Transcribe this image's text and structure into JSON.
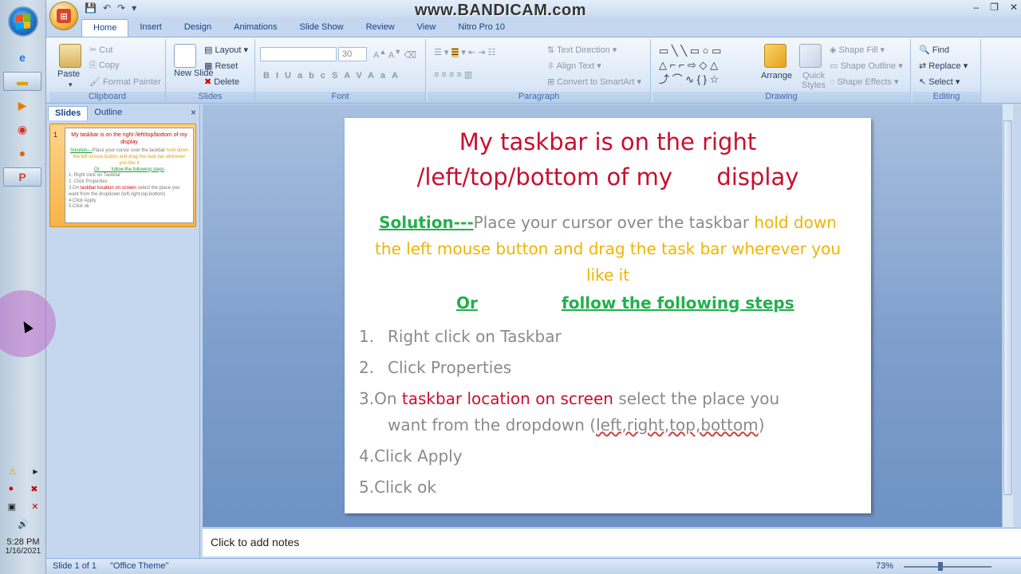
{
  "watermark": "www.BANDICAM.com",
  "qat": {
    "save": "💾",
    "undo": "↶",
    "redo": "↷",
    "more": "▾"
  },
  "window_controls": {
    "minimize": "‒",
    "restore": "❐",
    "close": "✕"
  },
  "tabs": [
    "Home",
    "Insert",
    "Design",
    "Animations",
    "Slide Show",
    "Review",
    "View",
    "Nitro Pro 10"
  ],
  "ribbon": {
    "clipboard": {
      "label": "Clipboard",
      "paste": "Paste",
      "cut": "Cut",
      "copy": "Copy",
      "format_painter": "Format Painter"
    },
    "slides": {
      "label": "Slides",
      "new_slide": "New Slide",
      "layout": "Layout",
      "reset": "Reset",
      "delete": "Delete"
    },
    "font": {
      "label": "Font",
      "font_size": "30",
      "buttons": [
        "B",
        "I",
        "U",
        "abc",
        "S",
        "AV",
        "Aa",
        "A"
      ]
    },
    "paragraph": {
      "label": "Paragraph",
      "text_direction": "Text Direction",
      "align_text": "Align Text",
      "smartart": "Convert to SmartArt"
    },
    "drawing": {
      "label": "Drawing",
      "arrange": "Arrange",
      "quick_styles": "Quick Styles",
      "shape_fill": "Shape Fill",
      "shape_outline": "Shape Outline",
      "shape_effects": "Shape Effects"
    },
    "editing": {
      "label": "Editing",
      "find": "Find",
      "replace": "Replace",
      "select": "Select"
    }
  },
  "panel": {
    "tab_slides": "Slides",
    "tab_outline": "Outline",
    "close": "×",
    "thumb_number": "1"
  },
  "slide": {
    "title_line1": "My taskbar is on the right",
    "title_line2": "/left/top/bottom of my      display",
    "solution_label": "Solution---",
    "solution_grey": "Place your cursor over the taskbar",
    "solution_yellow": " hold down the left mouse button and drag the task bar wherever you like it",
    "or": "Or",
    "follow": "follow the following steps",
    "step1_num": "1.",
    "step1": "Right click on Taskbar",
    "step2_num": "2.",
    "step2": "Click Properties",
    "step3_num": "3.On ",
    "step3_red": "taskbar location on screen",
    "step3_rest": " select the place you",
    "step3_line2a": "want from the dropdown (",
    "step3_options": "left,right,top,bottom",
    "step3_line2b": ")",
    "step4": "4.Click Apply",
    "step5": "5.Click ok"
  },
  "thumb": {
    "title": "My taskbar is on the right /left/top/bottom of my    display",
    "solution_label": "Solution---",
    "solution_grey": "Place your cursor over the taskbar",
    "solution_yellow": " hold down the left mouse button and drag the task bar wherever you like it",
    "or_follow": "Or         follow the following steps",
    "s1": "1.   Right click on Taskbar",
    "s2": "2.   Click Properties",
    "s3_pre": "3.On ",
    "s3_red": "taskbar location on screen",
    "s3_post": " select the place you want from the dropdown (left,right,top,bottom)",
    "s4": "4.Click Apply",
    "s5": "5.Click ok"
  },
  "notes_placeholder": "Click to add notes",
  "status": {
    "slide": "Slide 1 of 1",
    "theme": "\"Office Theme\"",
    "zoom": "73%"
  },
  "tray": {
    "time": "5:28 PM",
    "date": "1/16/2021"
  }
}
